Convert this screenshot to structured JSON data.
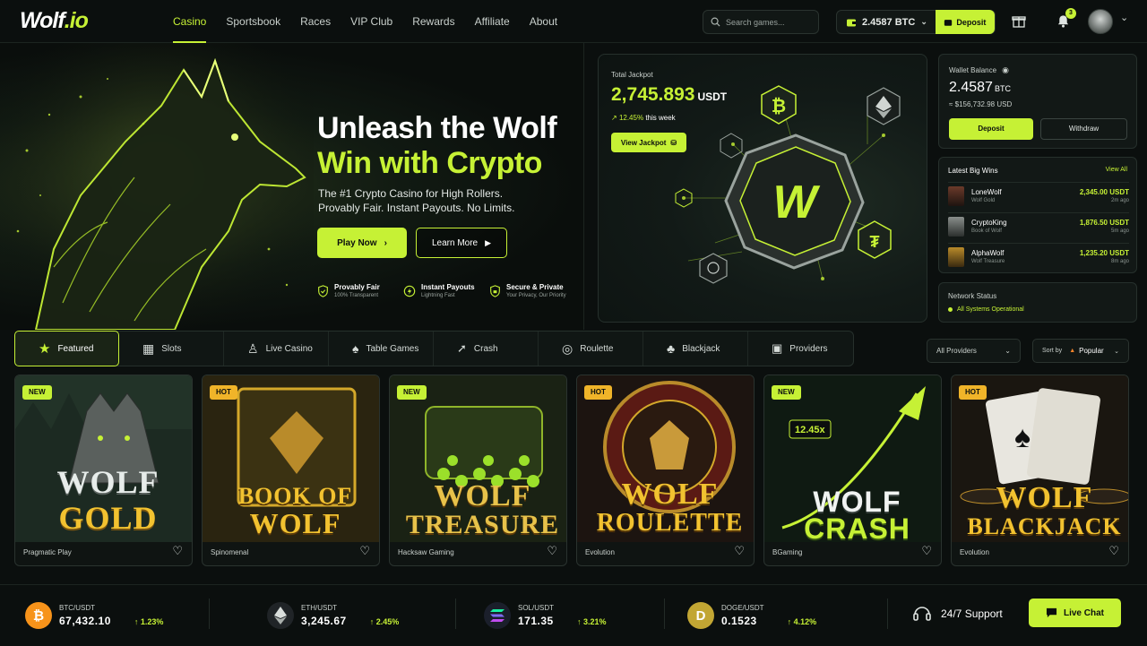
{
  "brand": {
    "logo_main": "Wolf",
    "logo_suffix": ".io",
    "accent": "#c6f135"
  },
  "nav": {
    "items": [
      "Casino",
      "Sportsbook",
      "Races",
      "VIP Club",
      "Rewards",
      "Affiliate",
      "About"
    ],
    "active": "Casino"
  },
  "header": {
    "search_placeholder": "Search games...",
    "wallet_balance": "2.4587 BTC",
    "deposit_label": "Deposit",
    "notification_count": "3"
  },
  "hero": {
    "title_line1": "Unleash the Wolf",
    "title_line2": "Win with Crypto",
    "subtitle_line1": "The #1 Crypto Casino for High Rollers.",
    "subtitle_line2": "Provably Fair. Instant Payouts. No Limits.",
    "play_label": "Play Now",
    "learn_label": "Learn More",
    "features": [
      {
        "title": "Provably Fair",
        "desc": "100% Transparent",
        "icon": "shield-check-icon"
      },
      {
        "title": "Instant Payouts",
        "desc": "Lightning Fast",
        "icon": "bolt-icon"
      },
      {
        "title": "Secure & Private",
        "desc": "Your Privacy, Our Priority",
        "icon": "shield-lock-icon"
      }
    ]
  },
  "jackpot": {
    "label": "Total Jackpot",
    "amount": "2,745.893",
    "unit": "USDT",
    "change": "12.45%",
    "change_suffix": "this week",
    "button": "View Jackpot"
  },
  "wallet_panel": {
    "title": "Wallet Balance",
    "amount": "2.4587",
    "unit": "BTC",
    "usd": "≈ $156,732.98 USD",
    "deposit": "Deposit",
    "withdraw": "Withdraw"
  },
  "big_wins": {
    "title": "Latest Big Wins",
    "view_all": "View All",
    "rows": [
      {
        "user": "LoneWolf",
        "game": "Wolf Gold",
        "amount": "2,345.00 USDT",
        "time": "2m ago"
      },
      {
        "user": "CryptoKing",
        "game": "Book of Wolf",
        "amount": "1,876.50 USDT",
        "time": "5m ago"
      },
      {
        "user": "AlphaWolf",
        "game": "Wolf Treasure",
        "amount": "1,235.20 USDT",
        "time": "8m ago"
      }
    ]
  },
  "network": {
    "title": "Network Status",
    "status": "All Systems Operational"
  },
  "categories": [
    {
      "label": "Featured",
      "icon": "star-icon"
    },
    {
      "label": "Slots",
      "icon": "slot-machine-icon"
    },
    {
      "label": "Live Casino",
      "icon": "dealer-icon"
    },
    {
      "label": "Table Games",
      "icon": "cards-icon"
    },
    {
      "label": "Crash",
      "icon": "rocket-icon"
    },
    {
      "label": "Roulette",
      "icon": "roulette-icon"
    },
    {
      "label": "Blackjack",
      "icon": "blackjack-cards-icon"
    },
    {
      "label": "Providers",
      "icon": "grid-icon"
    }
  ],
  "filters": {
    "providers": "All Providers",
    "sort_label": "Sort by",
    "sort_value": "Popular"
  },
  "games": [
    {
      "tag": "NEW",
      "title1": "WOLF",
      "title2": "GOLD",
      "provider": "Pragmatic Play"
    },
    {
      "tag": "HOT",
      "title1": "BOOK OF",
      "title2": "WOLF",
      "provider": "Spinomenal"
    },
    {
      "tag": "NEW",
      "title1": "WOLF",
      "title2": "TREASURE",
      "provider": "Hacksaw Gaming"
    },
    {
      "tag": "HOT",
      "title1": "WOLF",
      "title2": "ROULETTE",
      "provider": "Evolution"
    },
    {
      "tag": "NEW",
      "title1": "WOLF",
      "title2": "CRASH",
      "provider": "BGaming",
      "multiplier": "12.45x"
    },
    {
      "tag": "HOT",
      "title1": "WOLF",
      "title2": "BLACKJACK",
      "provider": "Evolution"
    }
  ],
  "ticker": [
    {
      "pair": "BTC/USDT",
      "price": "67,432.10",
      "change": "1.23%",
      "coin": "bitcoin-icon",
      "glyph": "₿",
      "color": "#f7931a"
    },
    {
      "pair": "ETH/USDT",
      "price": "3,245.67",
      "change": "2.45%",
      "coin": "ethereum-icon",
      "glyph": "◆",
      "color": "#2b2f33"
    },
    {
      "pair": "SOL/USDT",
      "price": "171.35",
      "change": "3.21%",
      "coin": "solana-icon",
      "glyph": "≡",
      "color": "#1b1f2b"
    },
    {
      "pair": "DOGE/USDT",
      "price": "0.1523",
      "change": "4.12%",
      "coin": "dogecoin-icon",
      "glyph": "D",
      "color": "#c2a633"
    }
  ],
  "support": {
    "label": "24/7 Support",
    "chat": "Live Chat"
  }
}
